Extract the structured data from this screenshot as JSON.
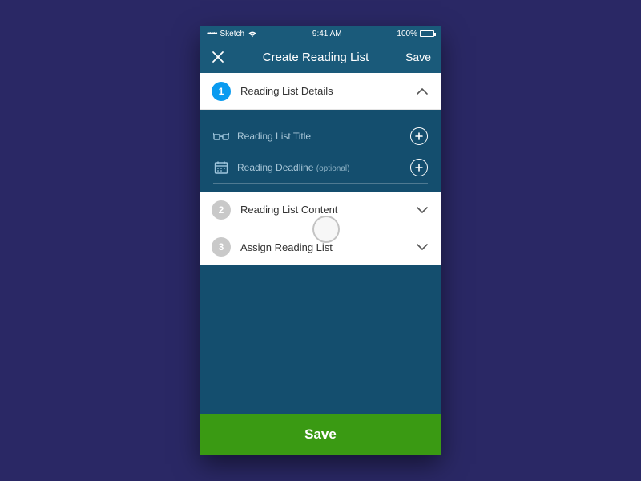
{
  "status": {
    "carrier": "Sketch",
    "dots": "•••••",
    "time": "9:41 AM",
    "battery_pct": "100%"
  },
  "nav": {
    "title": "Create Reading List",
    "save_label": "Save"
  },
  "sections": [
    {
      "num": "1",
      "title": "Reading List Details",
      "expanded": true,
      "fields": [
        {
          "icon": "glasses",
          "label": "Reading List Title",
          "optional": ""
        },
        {
          "icon": "calendar",
          "label": "Reading Deadline",
          "optional": "(optional)"
        }
      ]
    },
    {
      "num": "2",
      "title": "Reading List Content",
      "expanded": false
    },
    {
      "num": "3",
      "title": "Assign Reading List",
      "expanded": false
    }
  ],
  "footer": {
    "save_label": "Save"
  }
}
